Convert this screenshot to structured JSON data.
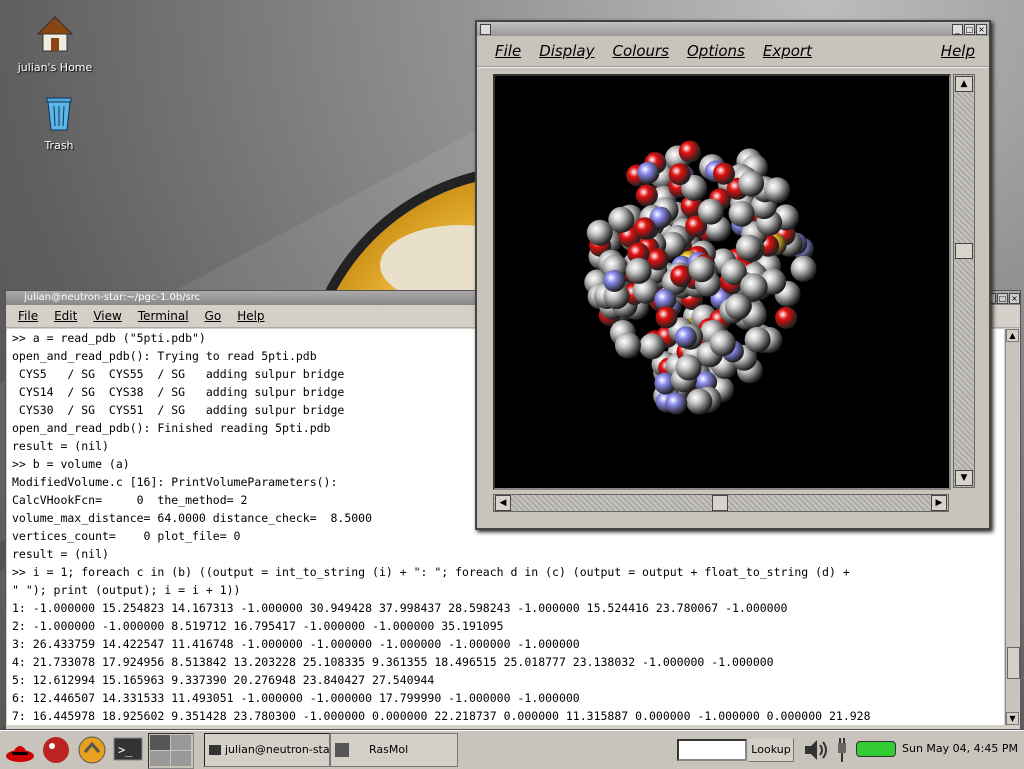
{
  "desktop": {
    "icons": [
      {
        "label": "julian's Home",
        "icon": "home-icon"
      },
      {
        "label": "Trash",
        "icon": "trash-icon"
      }
    ]
  },
  "terminal": {
    "title": "julian@neutron-star:~/pgc-1.0b/src",
    "menu": [
      "File",
      "Edit",
      "View",
      "Terminal",
      "Go",
      "Help"
    ],
    "lines": [
      ">> a = read_pdb (\"5pti.pdb\")",
      "open_and_read_pdb(): Trying to read 5pti.pdb",
      " CYS5   / SG  CYS55  / SG   adding sulpur bridge",
      " CYS14  / SG  CYS38  / SG   adding sulpur bridge",
      " CYS30  / SG  CYS51  / SG   adding sulpur bridge",
      "open_and_read_pdb(): Finished reading 5pti.pdb",
      "result = (nil)",
      ">> b = volume (a)",
      "ModifiedVolume.c [16]: PrintVolumeParameters():",
      "CalcVHookFcn=     0  the_method= 2",
      "volume_max_distance= 64.0000 distance_check=  8.5000",
      "vertices_count=    0 plot_file= 0",
      "result = (nil)",
      ">> i = 1; foreach c in (b) ((output = int_to_string (i) + \": \"; foreach d in (c) (output = output + float_to_string (d) +",
      "\" \"); print (output); i = i + 1))",
      "1: -1.000000 15.254823 14.167313 -1.000000 30.949428 37.998437 28.598243 -1.000000 15.524416 23.780067 -1.000000",
      "2: -1.000000 -1.000000 8.519712 16.795417 -1.000000 -1.000000 35.191095",
      "3: 26.433759 14.422547 11.416748 -1.000000 -1.000000 -1.000000 -1.000000 -1.000000",
      "4: 21.733078 17.924956 8.513842 13.203228 25.108335 9.361355 18.496515 25.018777 23.138032 -1.000000 -1.000000",
      "5: 12.612994 15.165963 9.337390 20.276948 23.840427 27.540944",
      "6: 12.446507 14.331533 11.493051 -1.000000 -1.000000 17.799990 -1.000000 -1.000000",
      "7: 16.445978 18.925602 9.351428 23.780300 -1.000000 0.000000 22.218737 0.000000 11.315887 0.000000 -1.000000 0.000000 21.928"
    ]
  },
  "rasmol": {
    "menu": [
      "File",
      "Display",
      "Colours",
      "Options",
      "Export"
    ],
    "help": "Help"
  },
  "taskbar": {
    "tasks": [
      "julian@neutron-star",
      "RasMol"
    ],
    "lookup_label": "Lookup",
    "clock": "Sun May 04,  4:45 PM"
  },
  "colors": {
    "oxygen": "#e01010",
    "nitrogen": "#8c8cf0",
    "carbon": "#c8c8c8",
    "sulfur": "#f0c020"
  }
}
